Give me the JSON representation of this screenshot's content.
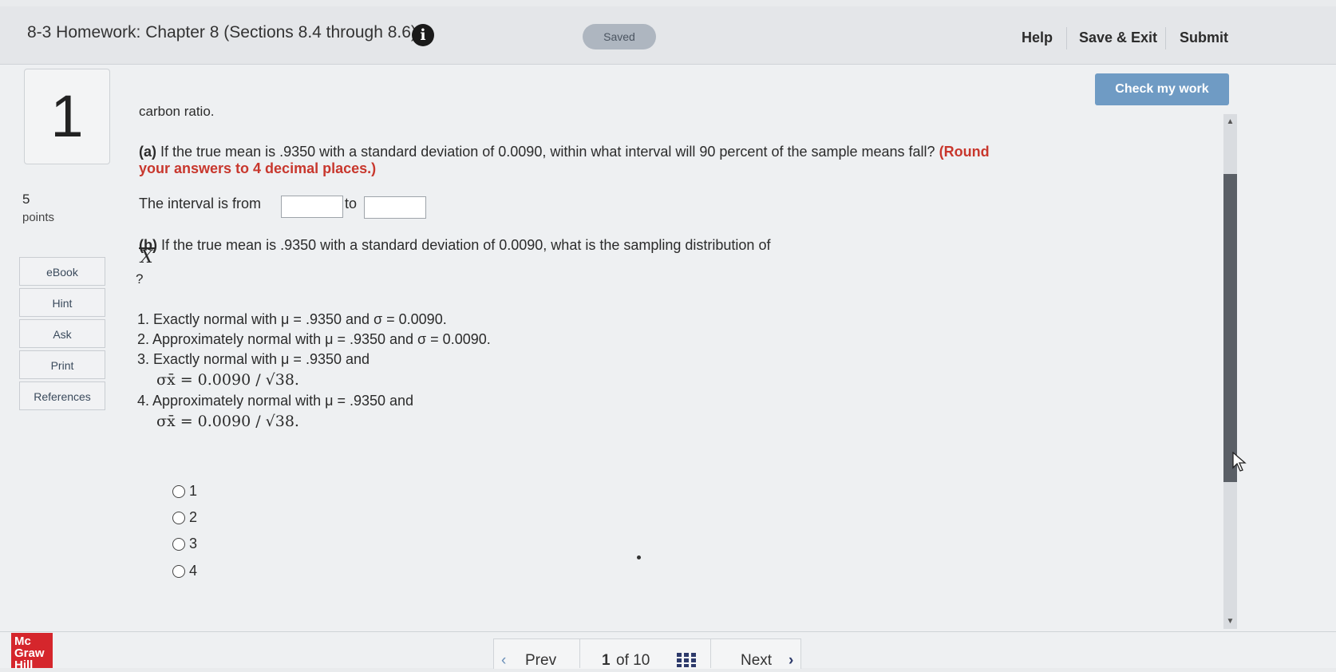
{
  "header": {
    "title": "8-3 Homework: Chapter 8 (Sections 8.4 through 8.6)",
    "info_icon": "info-icon",
    "saved_label": "Saved",
    "help_label": "Help",
    "save_exit_label": "Save & Exit",
    "submit_label": "Submit"
  },
  "question": {
    "number": "1",
    "points_value": "5",
    "points_label": "points",
    "check_label": "Check my work",
    "intro": "carbon ratio.",
    "part_a_tag": "(a)",
    "part_a_text": "If the true mean is .9350 with a standard deviation of 0.0090, within what interval will 90 percent of the sample means fall?",
    "part_a_round_1": "(Round",
    "part_a_round_2": "your answers to 4 decimal places.)",
    "interval_prefix": "The interval is from",
    "interval_to": "to",
    "input_from_value": "",
    "input_to_value": "",
    "part_b_tag": "(b)",
    "part_b_text": "If the true mean is .9350 with a standard deviation of 0.0090, what is the sampling distribution of",
    "xbar_symbol": "X",
    "question_mark": "?",
    "options": [
      "1. Exactly normal with μ = .9350 and σ = 0.0090.",
      "2. Approximately normal with μ = .9350 and σ = 0.0090.",
      "3. Exactly normal with μ = .9350 and",
      "4. Approximately normal with μ = .9350 and"
    ],
    "formula_3": "σx̄ = 0.0090 / √38.",
    "formula_4": "σx̄ = 0.0090 / √38.",
    "radio_labels": [
      "1",
      "2",
      "3",
      "4"
    ]
  },
  "sidebar": {
    "buttons": [
      "eBook",
      "Hint",
      "Ask",
      "Print",
      "References"
    ]
  },
  "footer": {
    "logo_text": "Mc Graw Hill",
    "prev_label": "Prev",
    "page_current": "1",
    "page_of": "of 10",
    "next_label": "Next"
  },
  "colors": {
    "accent_button": "#6f9bc4",
    "round_note": "#c8372d",
    "logo": "#d5262c"
  }
}
